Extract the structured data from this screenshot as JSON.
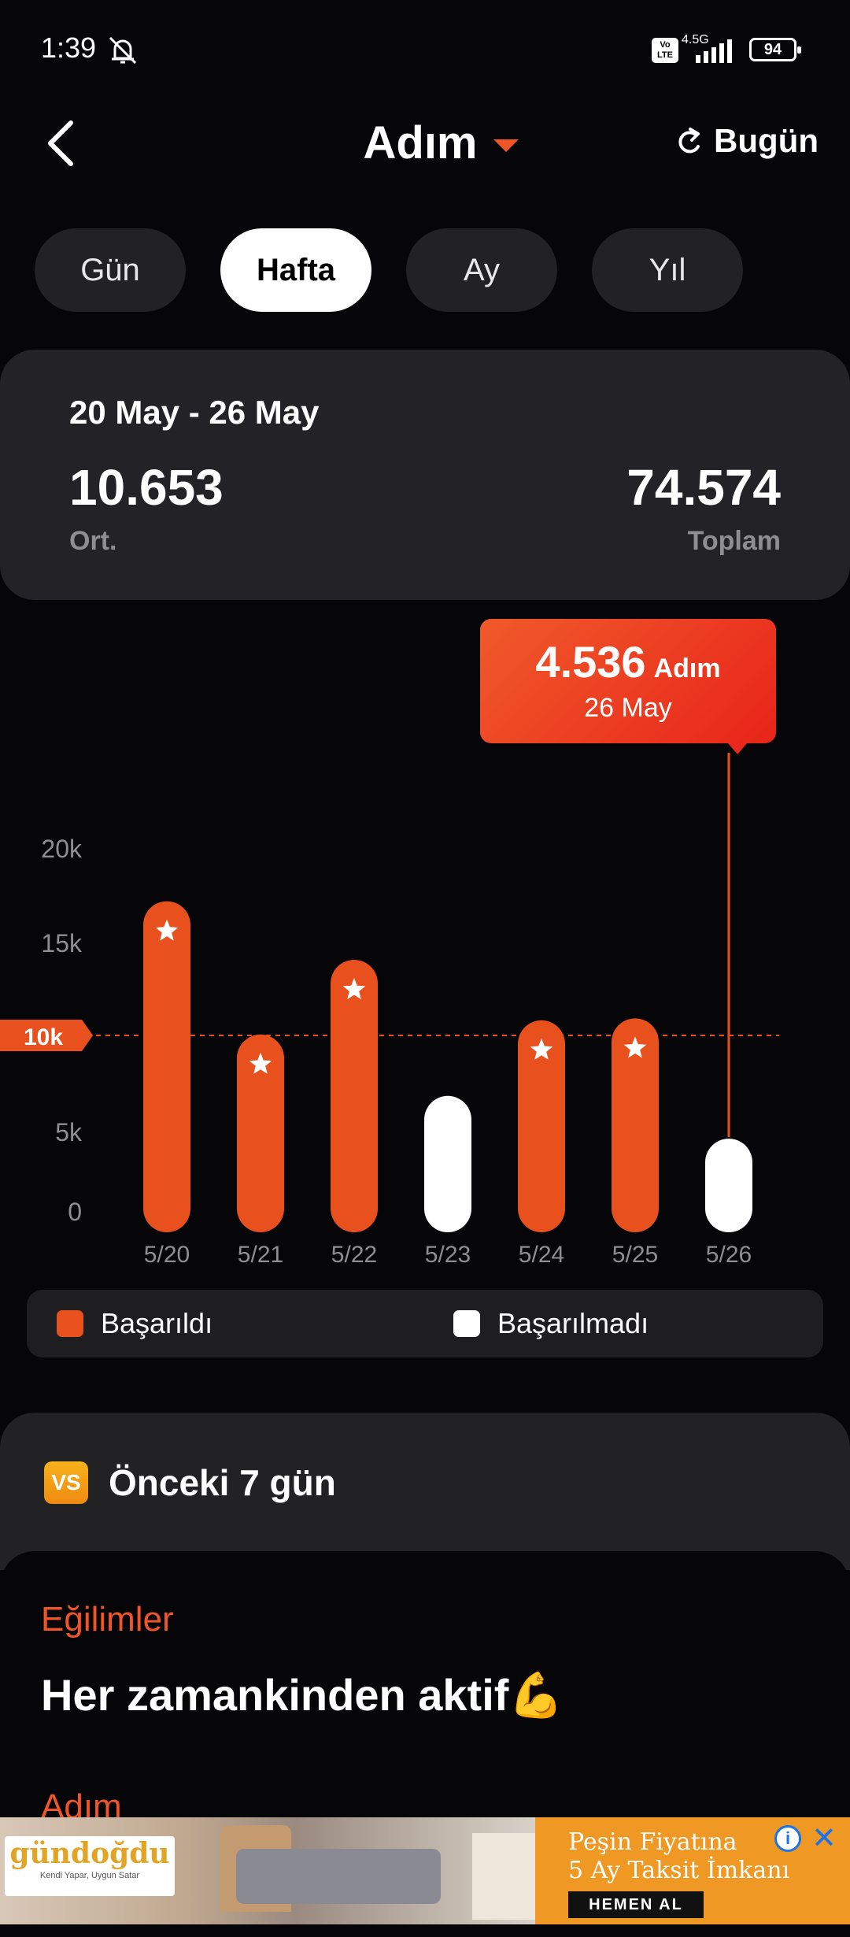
{
  "status_bar": {
    "time": "1:39",
    "network": "4.5G",
    "volte": "Vo LTE",
    "battery": "94"
  },
  "header": {
    "title": "Adım",
    "today_label": "Bugün"
  },
  "tabs": [
    {
      "label": "Gün",
      "active": false
    },
    {
      "label": "Hafta",
      "active": true
    },
    {
      "label": "Ay",
      "active": false
    },
    {
      "label": "Yıl",
      "active": false
    }
  ],
  "summary": {
    "range": "20 May - 26 May",
    "average": "10.653",
    "average_label": "Ort.",
    "total": "74.574",
    "total_label": "Toplam"
  },
  "tooltip": {
    "value": "4.536",
    "unit": "Adım",
    "date": "26 May"
  },
  "chart_data": {
    "type": "bar",
    "categories": [
      "5/20",
      "5/21",
      "5/22",
      "5/23",
      "5/24",
      "5/25",
      "5/26"
    ],
    "values": [
      17100,
      10050,
      14000,
      6800,
      10800,
      10900,
      4536
    ],
    "achieved": [
      true,
      true,
      true,
      false,
      true,
      true,
      false
    ],
    "y_ticks": [
      "0",
      "5k",
      "10k",
      "15k",
      "20k"
    ],
    "y_tick_values": [
      0,
      5000,
      10000,
      15000,
      20000
    ],
    "goal": 10000,
    "goal_label": "10k",
    "ylim": [
      0,
      20000
    ],
    "selected_index": 6,
    "colors": {
      "achieved": "#e8501e",
      "missed": "#ffffff",
      "goal": "#e8501e"
    }
  },
  "legend": {
    "achieved_label": "Başarıldı",
    "missed_label": "Başarılmadı"
  },
  "comparison": {
    "badge": "VS",
    "title": "Önceki 7 gün"
  },
  "trends": {
    "label": "Eğilimler",
    "text": "Her zamankinden aktif💪",
    "step_label": "Adım"
  },
  "ad": {
    "brand": "gündoğdu",
    "tagline": "Kendi Yapar, Uygun Satar",
    "line1": "Peşin Fiyatına",
    "line2": "5 Ay Taksit İmkanı",
    "cta": "HEMEN AL",
    "info": "i",
    "close": "✕"
  }
}
